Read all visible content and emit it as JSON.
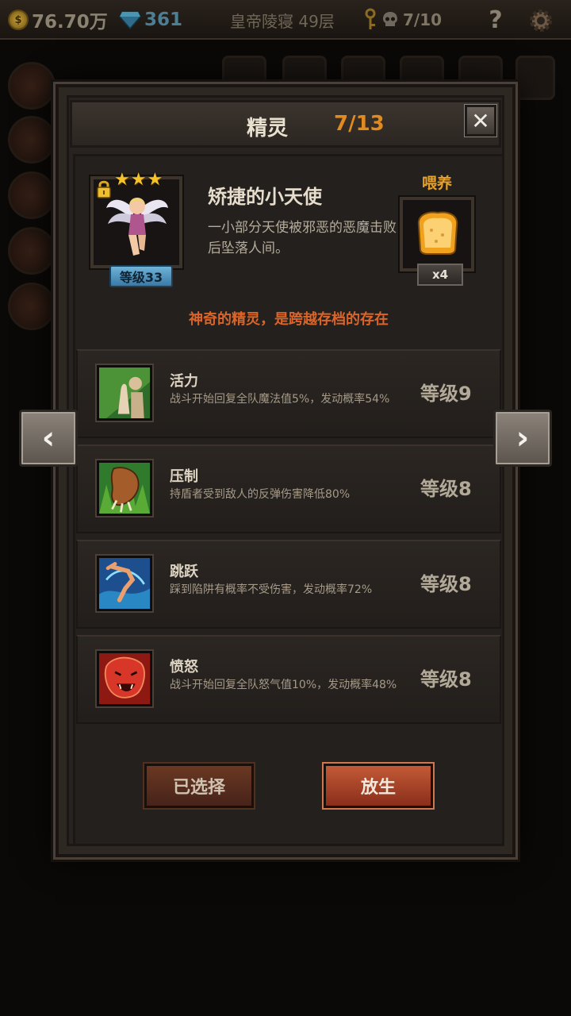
{
  "topbar": {
    "gold": "76.70万",
    "gems": "361",
    "location": "皇帝陵寝 49层",
    "keys": "7/10",
    "help_label": "?"
  },
  "modal": {
    "title": "精灵",
    "count": "7/13",
    "close_label": "✕"
  },
  "spirit": {
    "stars": "★★★",
    "level": "等级33",
    "name": "矫捷的小天使",
    "description": "一小部分天使被邪恶的恶魔击败后坠落人间。",
    "feed_label": "喂养",
    "feed_count": "x4",
    "tagline": "神奇的精灵，是跨越存档的存在"
  },
  "skills": [
    {
      "name": "活力",
      "desc": "战斗开始回复全队魔法值5%，发动概率54%",
      "level": "等级9",
      "icon": "praying-hands-icon"
    },
    {
      "name": "压制",
      "desc": "持盾者受到敌人的反弹伤害降低80%",
      "level": "等级8",
      "icon": "beast-claw-icon"
    },
    {
      "name": "跳跃",
      "desc": "踩到陷阱有概率不受伤害，发动概率72%",
      "level": "等级8",
      "icon": "leaping-figure-icon"
    },
    {
      "name": "愤怒",
      "desc": "战斗开始回复全队怒气值10%，发动概率48%",
      "level": "等级8",
      "icon": "roaring-lion-icon"
    }
  ],
  "buttons": {
    "selected": "已选择",
    "release": "放生"
  },
  "nav": {
    "prev": "‹",
    "next": "›"
  },
  "colors": {
    "accent_orange": "#e08a1f",
    "tagline_red": "#d9652a",
    "star_gold": "#f6c22a",
    "release_button": "#c35a36"
  }
}
